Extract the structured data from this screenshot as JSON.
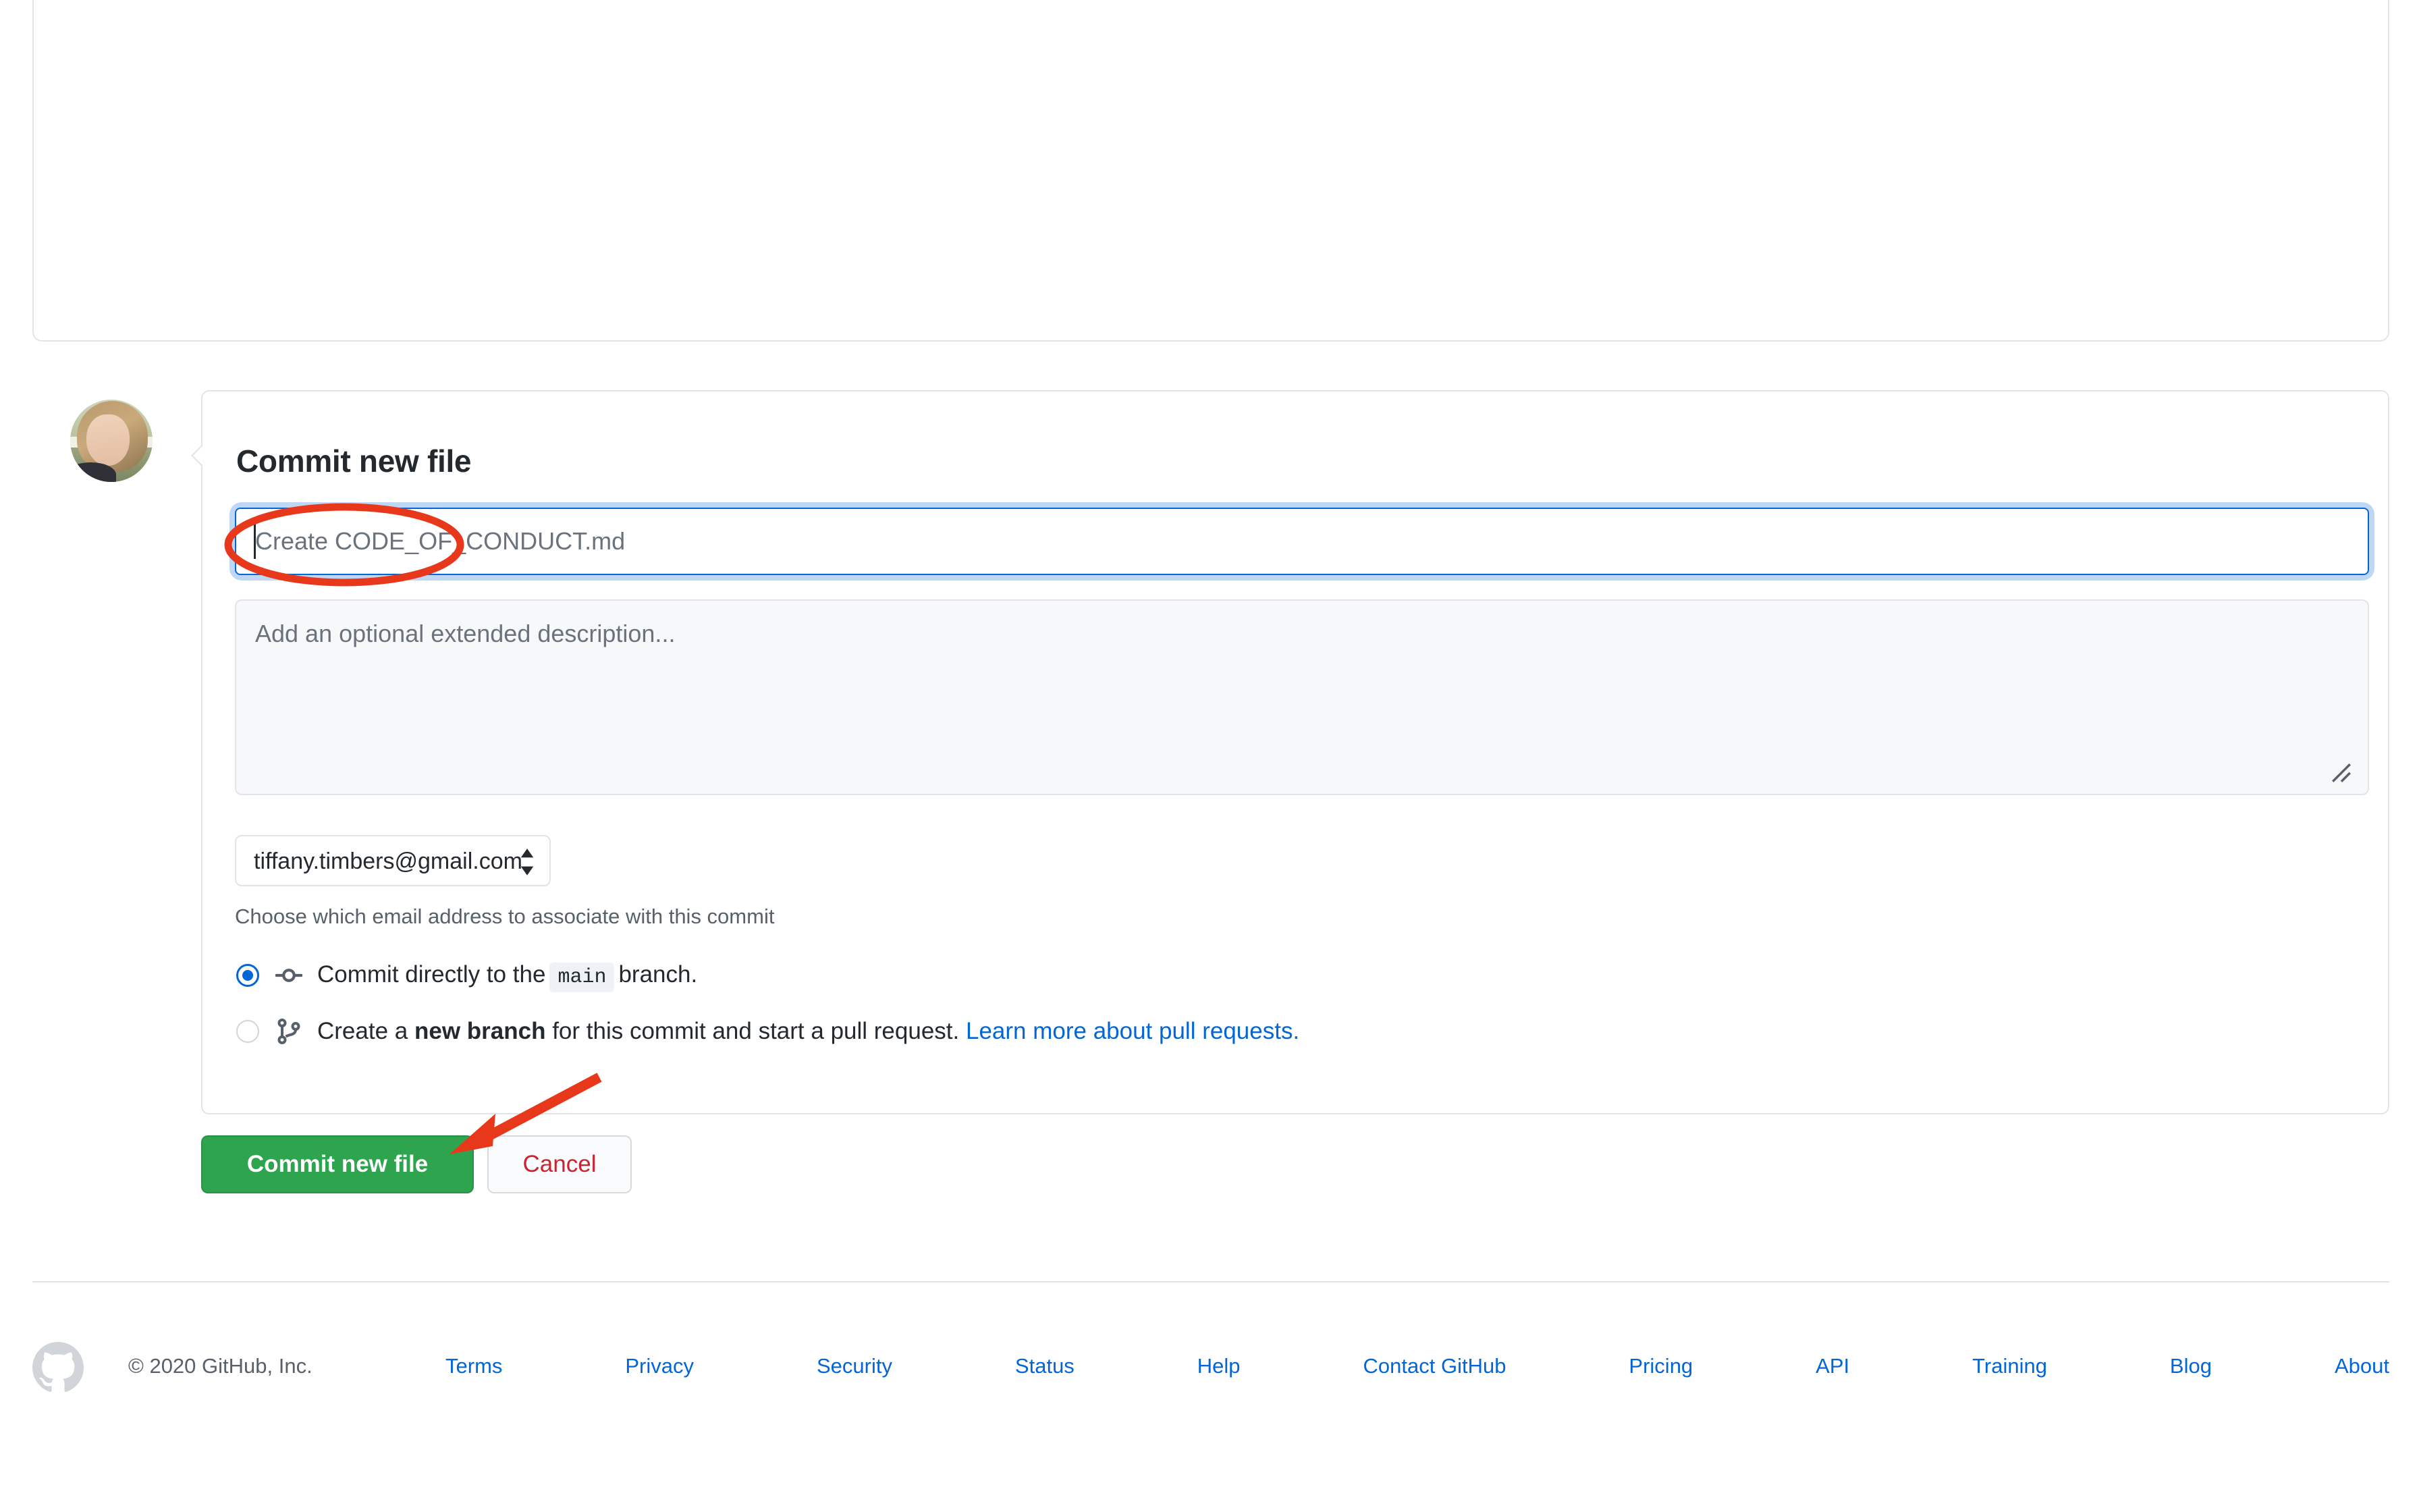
{
  "editor": {
    "content": ""
  },
  "avatar": {
    "alt": "user-avatar"
  },
  "form": {
    "title": "Commit new file",
    "commit_title": {
      "value": "",
      "placeholder": "Create CODE_OF_CONDUCT.md"
    },
    "description": {
      "value": "",
      "placeholder": "Add an optional extended description..."
    },
    "email": {
      "selected": "tiffany.timbers@gmail.com",
      "help": "Choose which email address to associate with this commit",
      "options": [
        "tiffany.timbers@gmail.com"
      ]
    },
    "branch_options": [
      {
        "id": "commit-directly",
        "checked": true,
        "icon": "git-commit-icon",
        "text_before": "Commit directly to the",
        "branch": "main",
        "text_after": "branch."
      },
      {
        "id": "create-new-branch",
        "checked": false,
        "icon": "git-branch-icon",
        "text_before": "Create a",
        "emphasis": "new branch",
        "text_after": "for this commit and start a pull request.",
        "link": "Learn more about pull requests."
      }
    ],
    "buttons": {
      "submit": "Commit new file",
      "cancel": "Cancel"
    }
  },
  "annotations": [
    {
      "name": "ellipse-highlight",
      "target": "commit-title-input",
      "color": "#e8381b"
    },
    {
      "name": "arrow-pointer",
      "target": "commit-new-file-button",
      "color": "#e8381b"
    }
  ],
  "footer": {
    "logo": "github-mark-icon",
    "copyright": "© 2020 GitHub, Inc.",
    "links": [
      "Terms",
      "Privacy",
      "Security",
      "Status",
      "Help",
      "Contact GitHub",
      "Pricing",
      "API",
      "Training",
      "Blog",
      "About"
    ]
  },
  "colors": {
    "accent_blue": "#0366d6",
    "button_green": "#2ea44f",
    "cancel_red": "#cb2431",
    "annotation_red": "#e8381b",
    "border": "#e1e4e8"
  }
}
